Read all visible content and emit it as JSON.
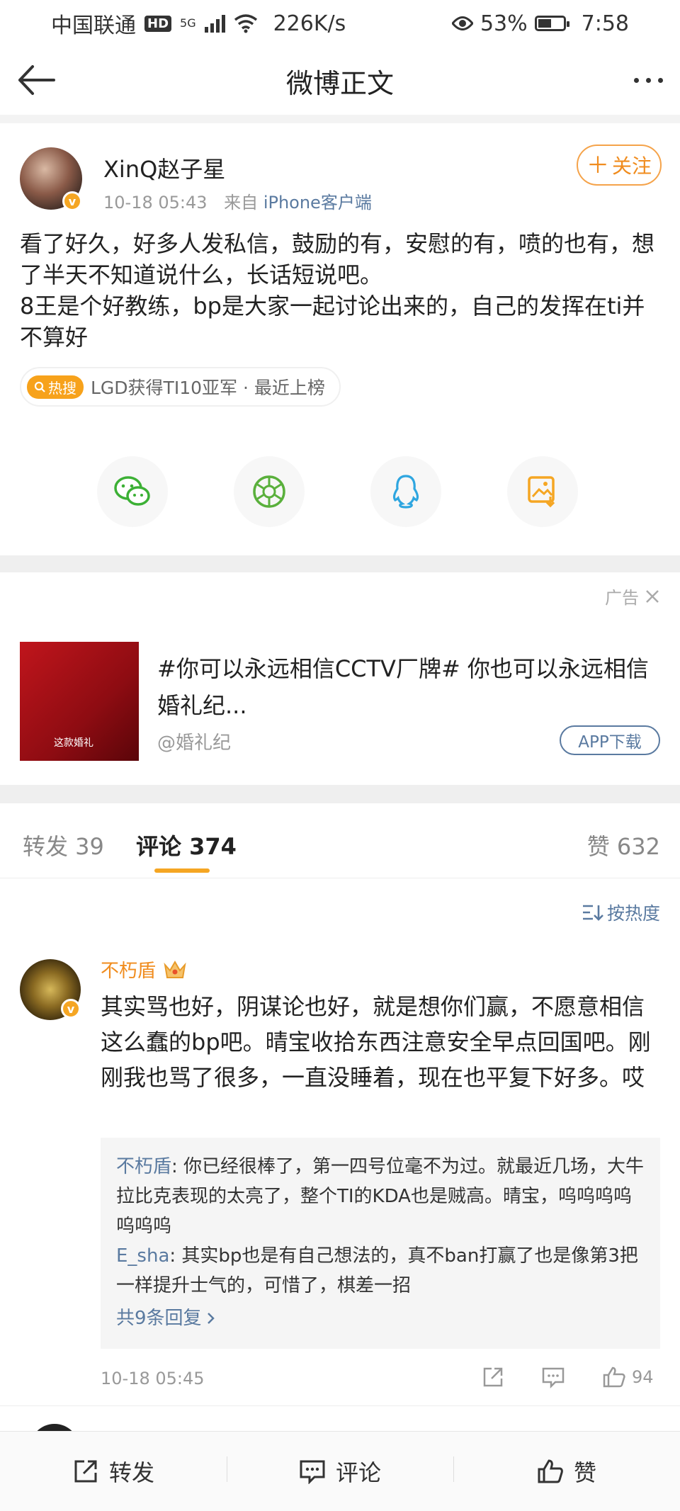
{
  "status_bar": {
    "carrier": "中国联通",
    "hd": "HD",
    "network": "5G",
    "speed": "226K/s",
    "battery": "53%",
    "battery_level": 0.53,
    "time": "7:58"
  },
  "nav": {
    "title": "微博正文"
  },
  "post": {
    "author": "XinQ赵子星",
    "time": "10-18 05:43",
    "source_prefix": "来自",
    "source": "iPhone客户端",
    "follow_label": "关注",
    "text_lines": [
      "看了好久，好多人发私信，鼓励的有，安慰的有，喷的也有，想了半天不知道说什么，长话短说吧。",
      "8王是个好教练，bp是大家一起讨论出来的，自己的发挥在ti并不算好"
    ],
    "hot_badge": "热搜",
    "hot_topic": "LGD获得TI10亚军 · 最近上榜",
    "share_icons": [
      "wechat-icon",
      "moments-icon",
      "qq-icon",
      "save-image-icon"
    ]
  },
  "ad": {
    "label": "广告",
    "title": "#你可以永远相信CCTV厂牌# 你也可以永远相信婚礼纪...",
    "account": "@婚礼纪",
    "app_button": "APP下载",
    "image_caption": "这款婚礼"
  },
  "tabs": {
    "repost": "转发 39",
    "comment": "评论 374",
    "like": "赞 632"
  },
  "sort_label": "按热度",
  "comment": {
    "author": "不朽盾",
    "text": "其实骂也好，阴谋论也好，就是想你们赢，不愿意相信这么蠢的bp吧。晴宝收拾东西注意安全早点回国吧。刚刚我也骂了很多，一直没睡着，现在也平复下好多。哎",
    "replies": [
      {
        "author": "不朽盾",
        "text": ": 你已经很棒了，第一四号位毫不为过。就最近几场，大牛拉比克表现的太亮了，整个TI的KDA也是贼高。晴宝，呜呜呜呜呜呜呜"
      },
      {
        "author": "E_sha",
        "text": ": 其实bp也是有自己想法的，真不ban打赢了也是像第3把一样提升士气的，可惜了，棋差一招"
      }
    ],
    "more_replies": "共9条回复",
    "time": "10-18 05:45",
    "likes": "94"
  },
  "bottom_bar": {
    "repost": "转发",
    "comment": "评论",
    "like": "赞"
  },
  "colors": {
    "accent_orange": "#f5a623",
    "link_blue": "#5a7aa0",
    "username_orange": "#f08c1e"
  }
}
